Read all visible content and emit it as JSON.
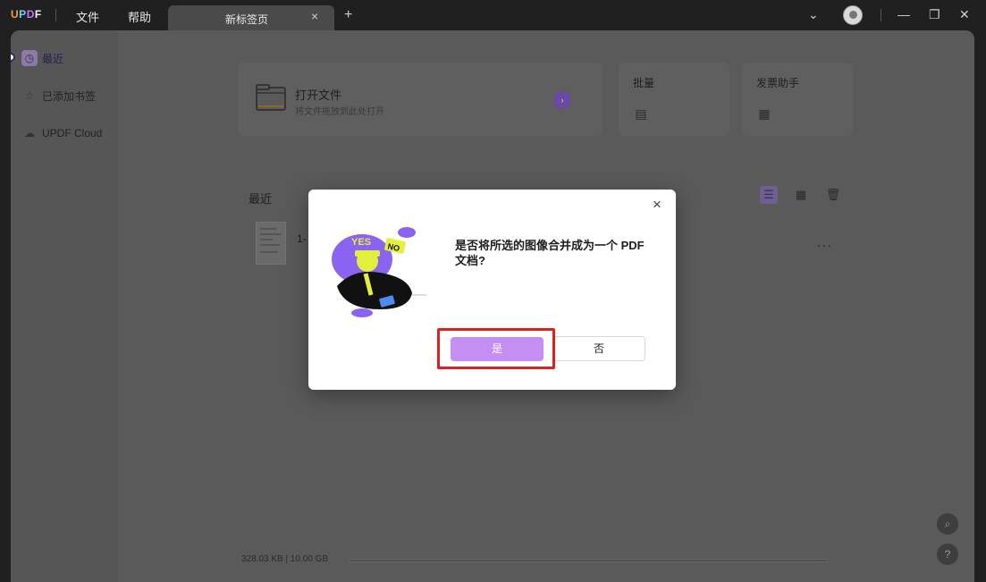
{
  "app": {
    "logo": "UPDF"
  },
  "menu": {
    "file": "文件",
    "help": "帮助"
  },
  "tab": {
    "label": "新标签页",
    "close": "×",
    "add": "+"
  },
  "window_controls": {
    "dropdown": "⌄",
    "minimize": "—",
    "restore": "❐",
    "close": "✕"
  },
  "sidebar": {
    "items": [
      {
        "label": "最近",
        "icon": "clock-icon",
        "glyph": "◷"
      },
      {
        "label": "已添加书签",
        "icon": "star-icon",
        "glyph": "☆"
      },
      {
        "label": "UPDF Cloud",
        "icon": "cloud-icon",
        "glyph": "☁"
      }
    ]
  },
  "open_card": {
    "title": "打开文件",
    "subtitle": "将文件拖放到此处打开",
    "badge": "›"
  },
  "batch_card": {
    "title": "批量",
    "glyph": "▤"
  },
  "invoice_card": {
    "title": "发票助手",
    "glyph": "▦"
  },
  "recent": {
    "title": "最近",
    "view_list_glyph": "☰",
    "view_grid_glyph": "▦",
    "delete_glyph": "🗑",
    "file": {
      "name": "1-",
      "more": "···"
    }
  },
  "storage": {
    "text": "328.03 KB | 10.00 GB"
  },
  "float": {
    "search": "⌕",
    "help": "?"
  },
  "dialog": {
    "close": "×",
    "message": "是否将所选的图像合并成为一个 PDF 文档?",
    "yes": "是",
    "no": "否",
    "illus_yes": "YES",
    "illus_no": "NO"
  },
  "colors": {
    "accent": "#c48ef3",
    "highlight": "#e0201c"
  }
}
